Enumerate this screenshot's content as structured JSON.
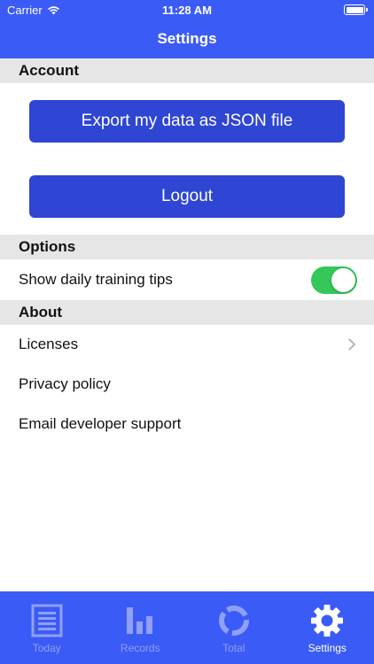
{
  "status_bar": {
    "carrier": "Carrier",
    "time": "11:28 AM"
  },
  "nav": {
    "title": "Settings"
  },
  "account": {
    "header": "Account",
    "export_label": "Export my data as JSON file",
    "logout_label": "Logout"
  },
  "options": {
    "header": "Options",
    "daily_tips_label": "Show daily training tips",
    "daily_tips_enabled": true
  },
  "about": {
    "header": "About",
    "items": [
      {
        "label": "Licenses"
      },
      {
        "label": "Privacy policy"
      },
      {
        "label": "Email developer support"
      }
    ]
  },
  "tabbar": {
    "tabs": [
      {
        "label": "Today",
        "icon": "document-icon"
      },
      {
        "label": "Records",
        "icon": "bar-chart-icon"
      },
      {
        "label": "Total",
        "icon": "ring-chart-icon"
      },
      {
        "label": "Settings",
        "icon": "gear-icon",
        "active": true
      }
    ]
  },
  "colors": {
    "brand": "#3b5bf6",
    "button": "#2f45d4",
    "toggle_on": "#34c759",
    "section_bg": "#e6e6e6",
    "tab_inactive": "#8fa0f5"
  }
}
